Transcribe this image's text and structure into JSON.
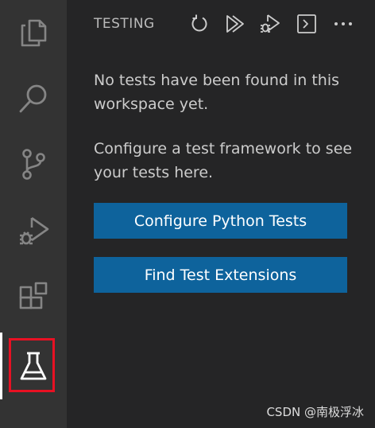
{
  "activity_bar": {
    "items": [
      {
        "name": "explorer",
        "icon": "files-icon"
      },
      {
        "name": "search",
        "icon": "search-icon"
      },
      {
        "name": "source-control",
        "icon": "source-control-icon"
      },
      {
        "name": "run-and-debug",
        "icon": "run-debug-icon"
      },
      {
        "name": "extensions",
        "icon": "extensions-icon"
      },
      {
        "name": "testing",
        "icon": "beaker-icon",
        "active": true
      }
    ],
    "highlight_color": "#e81123"
  },
  "sidebar": {
    "title": "TESTING",
    "toolbar": [
      "refresh-icon",
      "run-tests-icon",
      "debug-tests-icon",
      "terminal-icon",
      "more-actions-icon"
    ],
    "message_1": "No tests have been found in this workspace yet.",
    "message_2": "Configure a test framework to see your tests here.",
    "configure_button": "Configure Python Tests",
    "find_extensions_button": "Find Test Extensions",
    "button_color": "#0e639c"
  },
  "watermark": "CSDN @南极浮冰"
}
